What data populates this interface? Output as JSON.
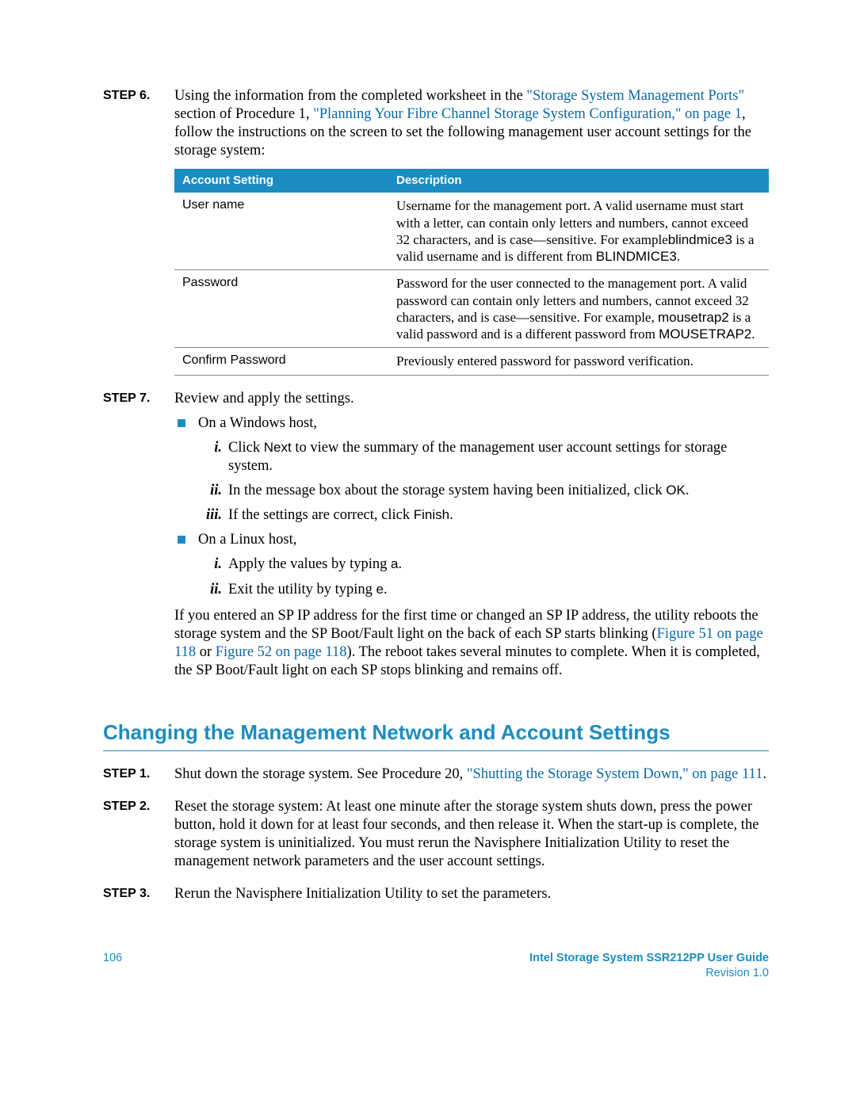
{
  "step6": {
    "label": "STEP 6.",
    "text_before_link1": "Using the information from the completed worksheet in the ",
    "link1": "\"Storage System Management Ports\"",
    "text_mid1": " section of Procedure 1, ",
    "link2": "\"Planning Your Fibre Channel Storage System Configuration,\" on page 1",
    "text_after": ", follow the instructions on the screen to set the following management user account settings for the storage system:"
  },
  "table": {
    "headers": [
      "Account Setting",
      "Description"
    ],
    "rows": [
      {
        "setting": "User name",
        "desc_parts": [
          {
            "t": "Username for the management port. A valid username must start with a letter, can contain only letters and numbers, cannot exceed 32 characters, and is case—sensitive. For example"
          },
          {
            "t": "blindmice3",
            "sans": true
          },
          {
            "t": " is a valid username and is different from "
          },
          {
            "t": "BLINDMICE3",
            "sans": true
          },
          {
            "t": "."
          }
        ]
      },
      {
        "setting": "Password",
        "desc_parts": [
          {
            "t": "Password for the user connected to the management port. A valid password can contain only letters and numbers, cannot exceed 32 characters, and is case—sensitive. For example, "
          },
          {
            "t": "mousetrap2",
            "sans": true
          },
          {
            "t": " is a valid password and is a different password from "
          },
          {
            "t": "MOUSETRAP2",
            "sans": true
          },
          {
            "t": "."
          }
        ]
      },
      {
        "setting": "Confirm Password",
        "desc_parts": [
          {
            "t": "Previously entered password for password verification."
          }
        ]
      }
    ]
  },
  "step7": {
    "label": "STEP 7.",
    "intro": "Review and apply the settings.",
    "bullets": [
      {
        "text": "On a Windows host,",
        "subs": [
          {
            "marker": "i.",
            "parts": [
              {
                "t": "Click "
              },
              {
                "t": "Next",
                "sans": true
              },
              {
                "t": " to view the summary of the management user account settings for storage system."
              }
            ]
          },
          {
            "marker": "ii.",
            "parts": [
              {
                "t": "In the message box about the storage system having been initialized, click "
              },
              {
                "t": "OK",
                "sans": true
              },
              {
                "t": "."
              }
            ]
          },
          {
            "marker": "iii.",
            "parts": [
              {
                "t": "If the settings are correct, click "
              },
              {
                "t": "Finish",
                "sans": true
              },
              {
                "t": "."
              }
            ]
          }
        ]
      },
      {
        "text": "On a Linux host,",
        "subs": [
          {
            "marker": "i.",
            "parts": [
              {
                "t": "Apply the values by typing "
              },
              {
                "t": "a",
                "sans": true
              },
              {
                "t": "."
              }
            ]
          },
          {
            "marker": "ii.",
            "parts": [
              {
                "t": "Exit the utility by typing "
              },
              {
                "t": "e",
                "sans": true
              },
              {
                "t": "."
              }
            ]
          }
        ]
      }
    ],
    "after_parts": [
      {
        "t": "If you entered an SP IP address for the first time or changed an SP IP address, the utility reboots the storage system and the SP Boot/Fault light on the back of each SP starts blinking ("
      },
      {
        "t": "Figure 51 on page 118",
        "link": true
      },
      {
        "t": " or "
      },
      {
        "t": "Figure 52 on page 118",
        "link": true
      },
      {
        "t": "). The reboot takes several minutes to complete. When it is completed, the SP Boot/Fault light on each SP stops blinking and remains off."
      }
    ]
  },
  "heading2": "Changing the Management Network and Account Settings",
  "sec2": {
    "step1": {
      "label": "STEP 1.",
      "parts": [
        {
          "t": "Shut down the storage system. See Procedure 20, "
        },
        {
          "t": "\"Shutting the Storage System Down,\" on page 111",
          "link": true
        },
        {
          "t": "."
        }
      ]
    },
    "step2": {
      "label": "STEP 2.",
      "text": "Reset the storage system: At least one minute after the storage system shuts down, press the power button, hold it down for at least four seconds, and then release it. When the start-up is complete, the storage system is uninitialized. You must rerun the Navisphere Initialization Utility to reset the management network parameters and the user account settings."
    },
    "step3": {
      "label": "STEP 3.",
      "text": "Rerun the Navisphere Initialization Utility to set the parameters."
    }
  },
  "footer": {
    "page": "106",
    "title": "Intel Storage System SSR212PP User Guide",
    "rev": "Revision 1.0"
  }
}
